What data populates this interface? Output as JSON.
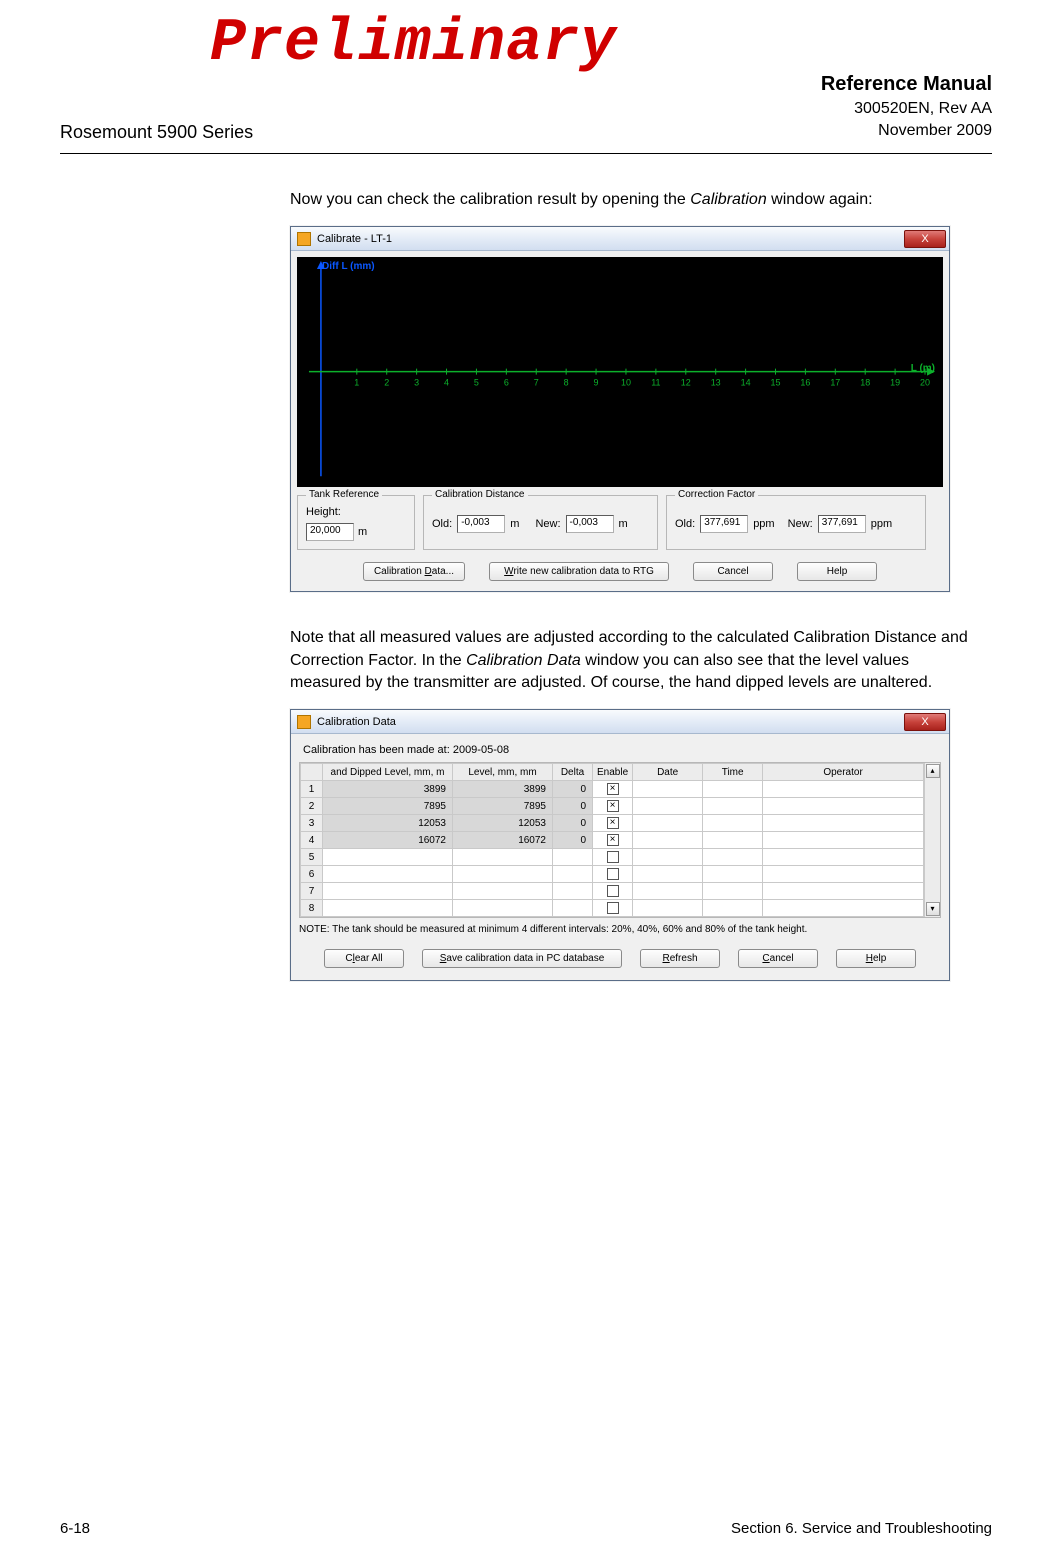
{
  "watermark": "Preliminary",
  "header": {
    "left": "Rosemount 5900 Series",
    "manual": "Reference Manual",
    "docnum": "300520EN, Rev AA",
    "date": "November 2009"
  },
  "para1_a": "Now you can check the calibration result by opening the ",
  "para1_em": "Calibration",
  "para1_b": " window again:",
  "calibrate": {
    "title": "Calibrate - LT-1",
    "close": "X",
    "plot": {
      "ylabel": "Diff L (mm)",
      "xlabel": "L (m)",
      "ticks": [
        "1",
        "2",
        "3",
        "4",
        "5",
        "6",
        "7",
        "8",
        "9",
        "10",
        "11",
        "12",
        "13",
        "14",
        "15",
        "16",
        "17",
        "18",
        "19",
        "20"
      ]
    },
    "tankref": {
      "legend": "Tank Reference",
      "label": "Height:",
      "value": "20,000",
      "unit": "m"
    },
    "caldist": {
      "legend": "Calibration Distance",
      "old_lbl": "Old:",
      "old": "-0,003",
      "unit": "m",
      "new_lbl": "New:",
      "new": "-0,003"
    },
    "corr": {
      "legend": "Correction Factor",
      "old_lbl": "Old:",
      "old": "377,691",
      "unit": "ppm",
      "new_lbl": "New:",
      "new": "377,691"
    },
    "buttons": {
      "caldata": "Calibration Data...",
      "write": "Write new calibration data to RTG",
      "cancel": "Cancel",
      "help": "Help"
    }
  },
  "para2_a": "Note that all measured values are adjusted according to the calculated Calibration Distance and Correction Factor. In the ",
  "para2_em": "Calibration Data",
  "para2_b": " window you can also see that the level values measured by the transmitter are adjusted. Of course, the hand dipped levels are unaltered.",
  "caldata": {
    "title": "Calibration Data",
    "close": "X",
    "made_label": "Calibration has been made at: ",
    "made_date": "2009-05-08",
    "columns": [
      "",
      "and Dipped Level, mm, m",
      "Level, mm, mm",
      "Delta",
      "Enable",
      "Date",
      "Time",
      "Operator"
    ],
    "rows": [
      {
        "n": "1",
        "dip": "3899",
        "lvl": "3899",
        "delta": "0",
        "en": true
      },
      {
        "n": "2",
        "dip": "7895",
        "lvl": "7895",
        "delta": "0",
        "en": true
      },
      {
        "n": "3",
        "dip": "12053",
        "lvl": "12053",
        "delta": "0",
        "en": true
      },
      {
        "n": "4",
        "dip": "16072",
        "lvl": "16072",
        "delta": "0",
        "en": true
      },
      {
        "n": "5",
        "dip": "",
        "lvl": "",
        "delta": "",
        "en": false
      },
      {
        "n": "6",
        "dip": "",
        "lvl": "",
        "delta": "",
        "en": false
      },
      {
        "n": "7",
        "dip": "",
        "lvl": "",
        "delta": "",
        "en": false
      },
      {
        "n": "8",
        "dip": "",
        "lvl": "",
        "delta": "",
        "en": false
      }
    ],
    "note": "NOTE: The tank should be measured at minimum 4 different intervals:  20%, 40%, 60% and 80% of the tank height.",
    "buttons": {
      "clear": "Clear All",
      "save": "Save calibration data in PC database",
      "refresh": "Refresh",
      "cancel": "Cancel",
      "help": "Help"
    }
  },
  "footer": {
    "left": "6-18",
    "right": "Section 6. Service and Troubleshooting"
  },
  "chart_data": {
    "type": "line",
    "title": "",
    "xlabel": "L (m)",
    "ylabel": "Diff L (mm)",
    "x_ticks": [
      1,
      2,
      3,
      4,
      5,
      6,
      7,
      8,
      9,
      10,
      11,
      12,
      13,
      14,
      15,
      16,
      17,
      18,
      19,
      20
    ],
    "series": []
  }
}
